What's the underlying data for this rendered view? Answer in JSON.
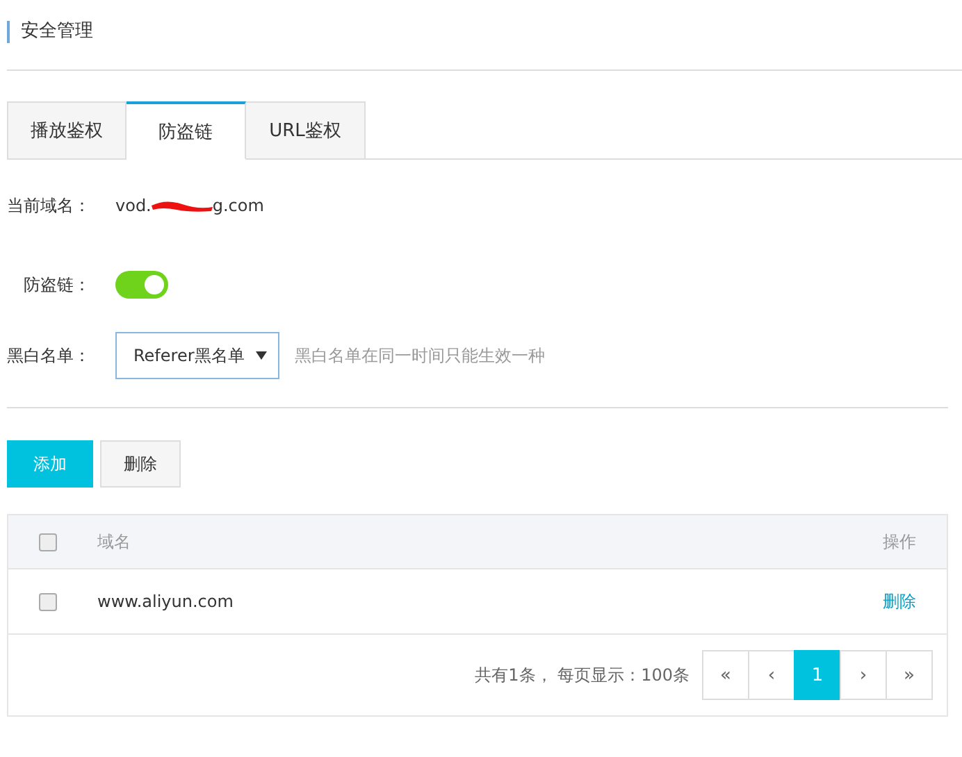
{
  "title": "安全管理",
  "tabs": [
    {
      "label": "播放鉴权",
      "selected": false
    },
    {
      "label": "防盗链",
      "selected": true
    },
    {
      "label": "URL鉴权",
      "selected": false
    }
  ],
  "domain": {
    "label": "当前域名：",
    "prefix": "vod.",
    "suffix": "g.com"
  },
  "hotlink": {
    "label": "防盗链：",
    "on": true
  },
  "list_type": {
    "label": "黑白名单：",
    "value": "Referer黑名单",
    "hint": "黑白名单在同一时间只能生效一种"
  },
  "buttons": [
    {
      "label": "添加",
      "kind": "primary"
    },
    {
      "label": "删除",
      "kind": "default"
    }
  ],
  "table": {
    "columns": [
      "域名",
      "操作"
    ],
    "header_checked": false,
    "rows": [
      {
        "checked": false,
        "domain": "www.aliyun.com",
        "action": "删除"
      }
    ]
  },
  "pagination": {
    "summary": "共有1条， 每页显示：100条",
    "pages": [
      {
        "label": "«",
        "selected": false
      },
      {
        "label": "‹",
        "selected": false
      },
      {
        "label": "1",
        "selected": true
      },
      {
        "label": "›",
        "selected": false
      },
      {
        "label": "»",
        "selected": false
      }
    ]
  }
}
